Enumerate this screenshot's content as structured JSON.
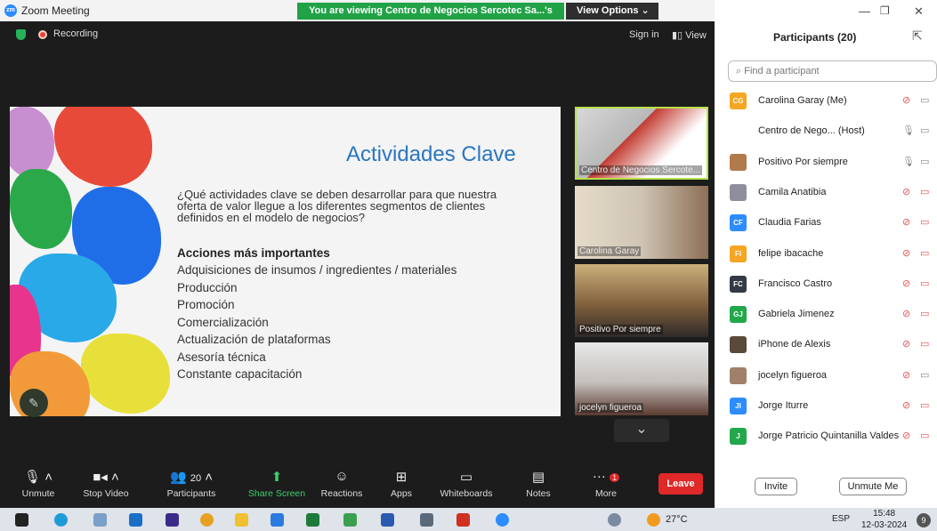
{
  "window": {
    "title": "Zoom Meeting",
    "share_banner": "You are viewing Centro de Negocios Sercotec Sa...'s screen",
    "view_options": "View Options"
  },
  "meeting": {
    "recording": "Recording",
    "sign_in": "Sign in",
    "view": "View"
  },
  "slide": {
    "title": "Actividades Clave",
    "question": "¿Qué actividades clave se deben desarrollar para que nuestra oferta de valor llegue a los diferentes segmentos de clientes definidos en el modelo de negocios?",
    "heading": "Acciones más importantes",
    "items": [
      "Adquisiciones de insumos / ingredientes / materiales",
      "Producción",
      "Promoción",
      "Comercialización",
      "Actualización de plataformas",
      "Asesoría técnica",
      "Constante capacitación"
    ]
  },
  "video_tiles": [
    "Centro de Negocios Sercote...",
    "Carolina Garay",
    "Positivo Por siempre",
    "jocelyn figueroa"
  ],
  "toolbar": {
    "unmute": "Unmute",
    "stop_video": "Stop Video",
    "participants": "Participants",
    "participants_count": "20",
    "share_screen": "Share Screen",
    "reactions": "Reactions",
    "apps": "Apps",
    "whiteboards": "Whiteboards",
    "notes": "Notes",
    "more": "More",
    "more_badge": "1",
    "leave": "Leave"
  },
  "panel": {
    "title": "Participants (20)",
    "search_placeholder": "Find a participant",
    "participants": [
      {
        "initials": "CG",
        "name": "Carolina Garay (Me)",
        "color": "#f5a623"
      },
      {
        "initials": "",
        "name": "Centro de Nego... (Host)",
        "color": "#ffffff"
      },
      {
        "initials": "",
        "name": "Positivo Por siempre",
        "color": "#b07a4a"
      },
      {
        "initials": "",
        "name": "Camila Anatibia",
        "color": "#8e8e9e"
      },
      {
        "initials": "CF",
        "name": "Claudia Farias",
        "color": "#2d8cff"
      },
      {
        "initials": "FI",
        "name": "felipe ibacache",
        "color": "#f5a623"
      },
      {
        "initials": "FC",
        "name": "Francisco Castro",
        "color": "#333a45"
      },
      {
        "initials": "GJ",
        "name": "Gabriela Jimenez",
        "color": "#22a84a"
      },
      {
        "initials": "",
        "name": "iPhone de Alexis",
        "color": "#5a4a3a"
      },
      {
        "initials": "",
        "name": "jocelyn figueroa",
        "color": "#a0806a"
      },
      {
        "initials": "JI",
        "name": "Jorge Iturre",
        "color": "#2d8cff"
      },
      {
        "initials": "J",
        "name": "Jorge Patricio Quintanilla Valdes",
        "color": "#22a84a"
      }
    ],
    "invite": "Invite",
    "unmute_me": "Unmute Me"
  },
  "taskbar": {
    "temperature": "27°C",
    "language": "ESP",
    "time": "15:48",
    "date": "12-03-2024",
    "notif_count": "9"
  }
}
